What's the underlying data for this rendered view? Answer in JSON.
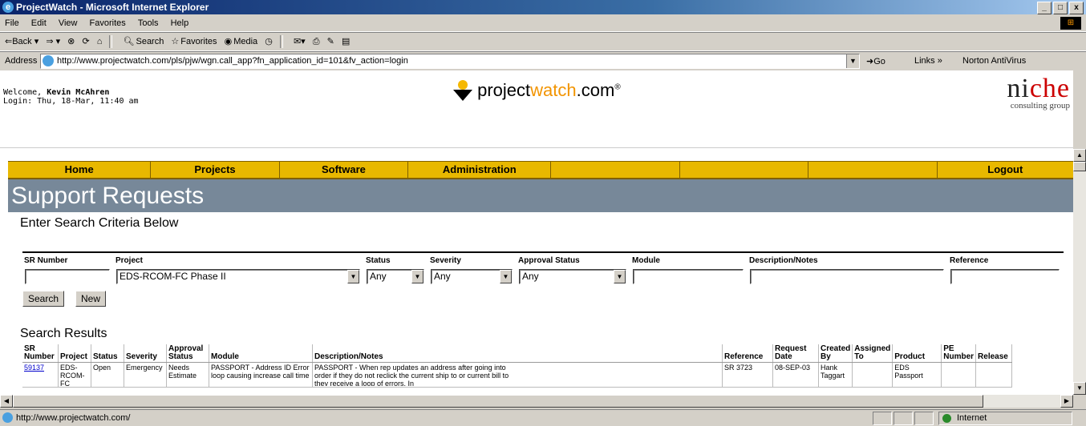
{
  "window": {
    "title": "ProjectWatch - Microsoft Internet Explorer",
    "controls": [
      "_",
      "□",
      "x"
    ]
  },
  "menu": [
    "File",
    "Edit",
    "View",
    "Favorites",
    "Tools",
    "Help"
  ],
  "toolbar": {
    "back": "⇐Back ▾",
    "forward": "⇒ ▾",
    "search": "Search",
    "favorites": "Favorites",
    "media": "Media"
  },
  "address": {
    "label": "Address",
    "url": "http://www.projectwatch.com/pls/pjw/wgn.call_app?fn_application_id=101&fv_action=login",
    "go": "Go",
    "links": "Links »",
    "norton": "Norton AntiVirus"
  },
  "header": {
    "welcome_prefix": "Welcome, ",
    "user": "Kevin McAhren",
    "login": "Login: Thu, 18-Mar, 11:40 am",
    "logo_a": "project",
    "logo_b": "watch",
    "logo_c": ".com",
    "logo_mark": "®",
    "niche_a": "ni",
    "niche_b": "che",
    "niche_sub": "consulting group"
  },
  "nav": [
    "Home",
    "Projects",
    "Software",
    "Administration",
    "",
    "",
    "",
    "Logout"
  ],
  "page_title": "Support Requests",
  "search": {
    "heading": "Enter Search Criteria Below",
    "columns": [
      "SR Number",
      "Project",
      "Status",
      "Severity",
      "Approval Status",
      "Module",
      "Description/Notes",
      "Reference"
    ],
    "values": {
      "sr": "",
      "project": "EDS-RCOM-FC Phase II",
      "status": "Any",
      "severity": "Any",
      "approval": "Any",
      "module": "",
      "description": "",
      "reference": ""
    },
    "search_btn": "Search",
    "new_btn": "New"
  },
  "results": {
    "heading": "Search Results",
    "columns": [
      "SR Number",
      "Project",
      "Status",
      "Severity",
      "Approval Status",
      "Module",
      "Description/Notes",
      "Reference",
      "Request Date",
      "Created By",
      "Assigned To",
      "Product",
      "PE Number",
      "Release"
    ],
    "rows": [
      {
        "sr": "59137",
        "project": "EDS-RCOM-FC",
        "status": "Open",
        "severity": "Emergency",
        "approval": "Needs Estimate",
        "module": "PASSPORT - Address ID Error loop causing increase call time",
        "description": "PASSPORT - When rep updates an address after going into order if they do not reclick the current ship to or current bill to they receive a loop of errors. In",
        "reference": "SR 3723",
        "date": "08-SEP-03",
        "created": "Hank Taggart",
        "assigned": "",
        "product": "EDS Passport",
        "pe": "",
        "release": ""
      }
    ]
  },
  "status": {
    "text": "http://www.projectwatch.com/",
    "zone": "Internet"
  }
}
